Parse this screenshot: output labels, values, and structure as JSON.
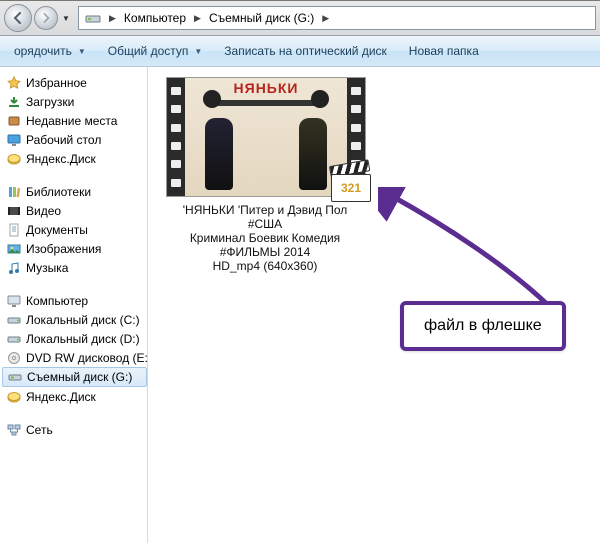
{
  "breadcrumb": {
    "root": "Компьютер",
    "current": "Съемный диск (G:)"
  },
  "toolbar": {
    "organize": "орядочить",
    "share": "Общий доступ",
    "burn": "Записать на оптический диск",
    "newfolder": "Новая папка"
  },
  "nav": {
    "favorites": {
      "header": "Избранное",
      "downloads": "Загрузки",
      "recent": "Недавние места",
      "desktop": "Рабочий стол",
      "yadisk": "Яндекс.Диск"
    },
    "libraries": {
      "header": "Библиотеки",
      "video": "Видео",
      "docs": "Документы",
      "images": "Изображения",
      "music": "Музыка"
    },
    "computer": {
      "header": "Компьютер",
      "c": "Локальный диск (C:)",
      "d": "Локальный диск (D:)",
      "dvd": "DVD RW дисковод (E:)",
      "usb": "Съемный диск (G:)",
      "yadisk": "Яндекс.Диск"
    },
    "network": {
      "header": "Сеть"
    }
  },
  "file": {
    "poster_title": "НЯНЬКИ",
    "mpc_badge": "321",
    "name_l1": "'НЯНЬКИ 'Питер и Дэвид Пол #США",
    "name_l2": "Криминал Боевик Комедия #ФИЛЬМЫ 2014",
    "name_l3": "HD_mp4 (640x360)"
  },
  "annotation": {
    "label": "файл в флешке"
  },
  "colors": {
    "accent": "#5c2d91"
  }
}
